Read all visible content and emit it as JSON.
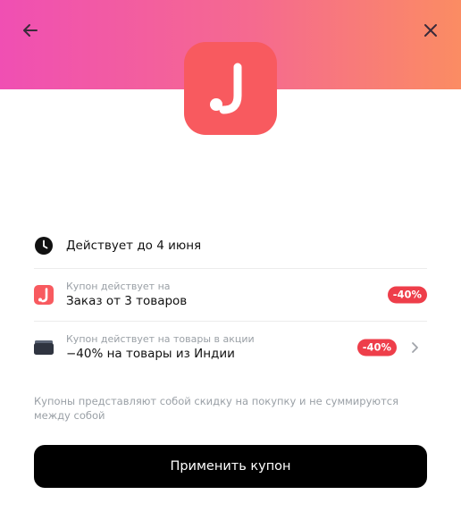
{
  "header": {
    "back_icon": "arrow-left-icon",
    "close_icon": "close-icon",
    "gradient": [
      "#f04fb3",
      "#fb8c63"
    ]
  },
  "logo": {
    "icon": "j-brand-logo",
    "color": "#f85a5f"
  },
  "expiry": {
    "icon": "clock-icon",
    "text": "Действует до 4 июня"
  },
  "coupons": [
    {
      "icon": "j-brand-small-icon",
      "label": "Купон действует на",
      "value": "Заказ от 3 товаров",
      "badge": "-40%",
      "has_chevron": false
    },
    {
      "icon": "wallet-icon",
      "label": "Купон действует на товары в акции",
      "value": "−40% на товары из Индии",
      "badge": "-40%",
      "has_chevron": true
    }
  ],
  "note": "Купоны представляют собой скидку на покупку и не суммируются между собой",
  "apply_button": {
    "label": "Применить купон"
  },
  "colors": {
    "badge": "#ee3e4a",
    "button": "#000000"
  }
}
